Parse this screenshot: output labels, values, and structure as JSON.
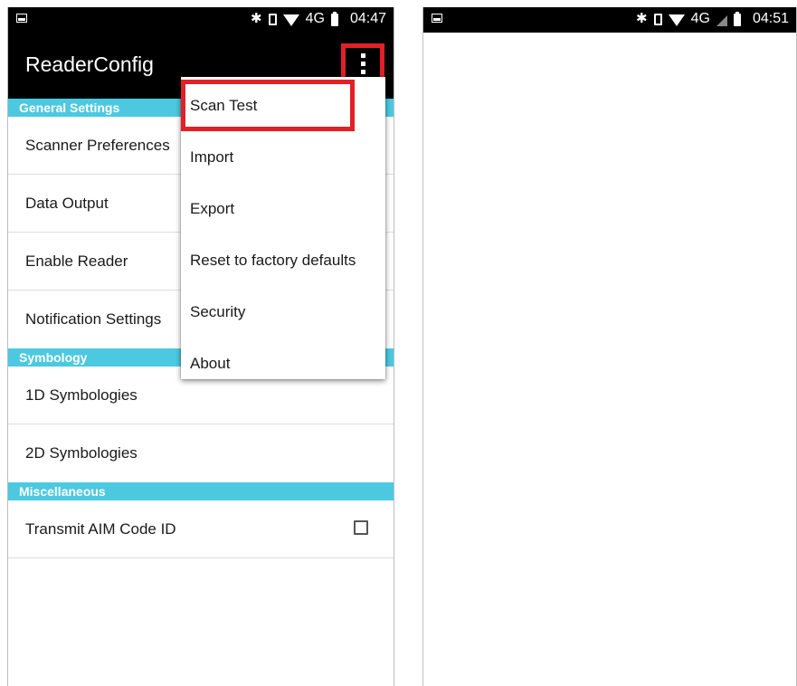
{
  "left_screen": {
    "status_bar": {
      "icons": [
        "image-icon",
        "bluetooth-icon",
        "vibrate-icon",
        "wifi-icon"
      ],
      "network": "4G",
      "time": "04:47"
    },
    "app_bar": {
      "title": "ReaderConfig"
    },
    "sections": [
      {
        "header": "General Settings",
        "items": [
          "Scanner Preferences",
          "Data Output",
          "Enable Reader",
          "Notification Settings"
        ]
      },
      {
        "header": "Symbology",
        "items": [
          "1D Symbologies",
          "2D Symbologies"
        ]
      },
      {
        "header": "Miscellaneous",
        "items": [
          {
            "label": "Transmit AIM Code ID",
            "checked": false
          }
        ]
      }
    ],
    "overflow_menu": {
      "items": [
        "Scan Test",
        "Import",
        "Export",
        "Reset to factory defaults",
        "Security",
        "About"
      ],
      "highlighted": "Scan Test"
    }
  },
  "right_screen": {
    "status_bar": {
      "icons": [
        "image-icon",
        "bluetooth-icon",
        "vibrate-icon",
        "wifi-icon",
        "signal-icon"
      ],
      "network": "4G",
      "time": "04:51"
    }
  },
  "colors": {
    "accent": "#4cc9e1",
    "highlight": "#e22027",
    "bar": "#000000"
  }
}
